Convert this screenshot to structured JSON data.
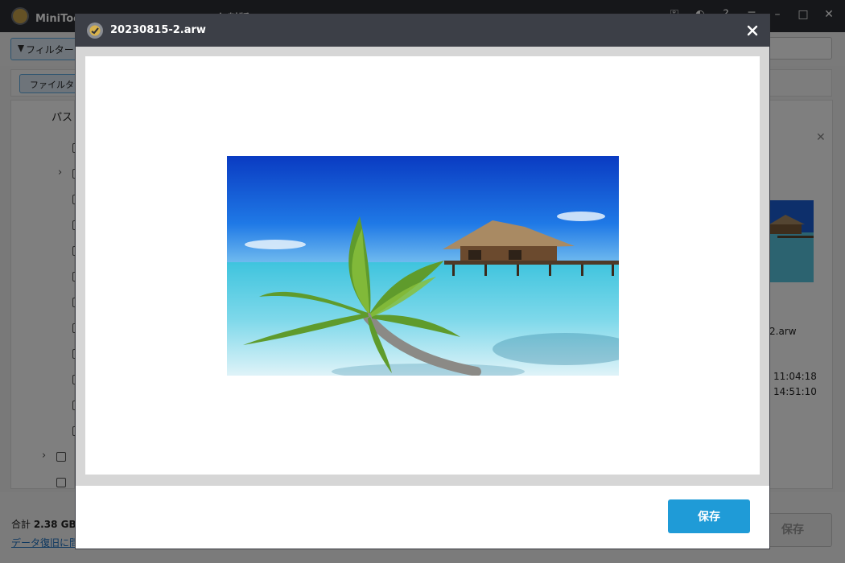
{
  "background_app": {
    "title": "MiniTool Power Data Recovery 無料版 - 12.0",
    "filter_label": "フィルター",
    "filetype_label": "ファイルタイプ",
    "tree": {
      "path_header": "パス"
    },
    "preview_panel": {
      "filename_fragment": "2.arw",
      "time1": "11:04:18",
      "time2": "14:51:10"
    },
    "status": {
      "total_prefix": "合計 ",
      "total_value": "2.38 GB /",
      "help_link": "データ復旧に問題"
    },
    "save_label": "保存"
  },
  "modal": {
    "title": "20230815-2.arw",
    "save_label": "保存"
  },
  "colors": {
    "modal_titlebar": "#3c3f47",
    "save_button": "#1f9bd7",
    "app_titlebar": "#2d2f35"
  },
  "icons": {
    "modal_app": "minitool-logo-icon",
    "close": "close-icon",
    "filter": "funnel-icon",
    "checkbox": "checkbox-icon",
    "expand": "chevron-right-icon"
  }
}
